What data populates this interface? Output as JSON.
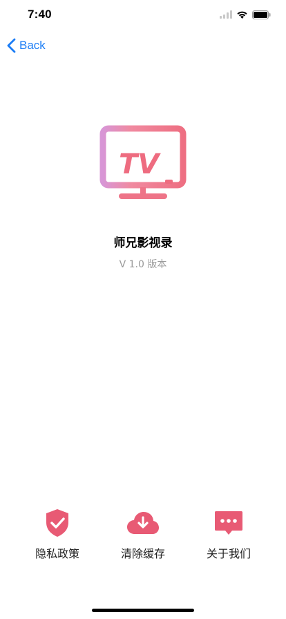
{
  "status_bar": {
    "time": "7:40"
  },
  "nav": {
    "back_label": "Back"
  },
  "logo": {
    "text": "TV"
  },
  "app": {
    "name": "师兄影视录",
    "version": "V 1.0 版本"
  },
  "actions": [
    {
      "label": "隐私政策",
      "icon": "shield-check-icon"
    },
    {
      "label": "清除缓存",
      "icon": "cloud-download-icon"
    },
    {
      "label": "关于我们",
      "icon": "chat-bubble-icon"
    }
  ],
  "colors": {
    "accent": "#e85a74",
    "link": "#1a7cf5",
    "muted": "#9a9a9a"
  }
}
